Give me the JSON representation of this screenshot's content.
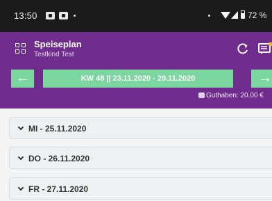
{
  "status_bar": {
    "time": "13:50",
    "battery": "72 %",
    "icons": [
      "notification-icon",
      "notification-icon",
      "dot-icon",
      "dot-icon",
      "wifi-icon",
      "signal-icon",
      "battery-icon"
    ]
  },
  "app_bar": {
    "title": "Speiseplan",
    "subtitle": "Testkind Test",
    "icons": [
      "grid-icon",
      "refresh-icon",
      "message-icon"
    ]
  },
  "week_nav": {
    "prev_label": "←",
    "week_label": "KW 48 || 23.11.2020 - 29.11.2020",
    "next_label": "→",
    "balance": "Guthaben: 20.00 €"
  },
  "days": [
    {
      "label": "MI - 25.11.2020"
    },
    {
      "label": "DO - 26.11.2020"
    },
    {
      "label": "FR - 27.11.2020"
    }
  ],
  "colors": {
    "header_purple": "#6f2c8c",
    "accent_green": "#7bd6a0",
    "status_bar": "#1b1b1b"
  }
}
